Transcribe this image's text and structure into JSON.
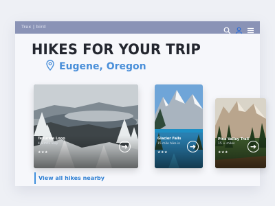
{
  "app": {
    "brand": "Trex | bird"
  },
  "header": {
    "title": "HIKES FOR YOUR TRIP",
    "location": "Eugene, Oregon"
  },
  "cards": [
    {
      "name": "Telluride Loop",
      "distance": "4.5 mile loop",
      "stars": "★★★"
    },
    {
      "name": "Glacier Falls",
      "distance": "15 mile hike in",
      "stars": "★★★"
    },
    {
      "name": "Pine Valley Trail",
      "distance": "15 + miles",
      "stars": "★★★"
    }
  ],
  "footer": {
    "view_all": "View all hikes nearby"
  },
  "colors": {
    "topbar": "#8a93b6",
    "accent": "#3f8fdc",
    "title": "#23262f"
  },
  "icons": [
    "search-icon",
    "user-icon",
    "menu-icon",
    "location-pin-icon",
    "arrow-right-icon"
  ]
}
